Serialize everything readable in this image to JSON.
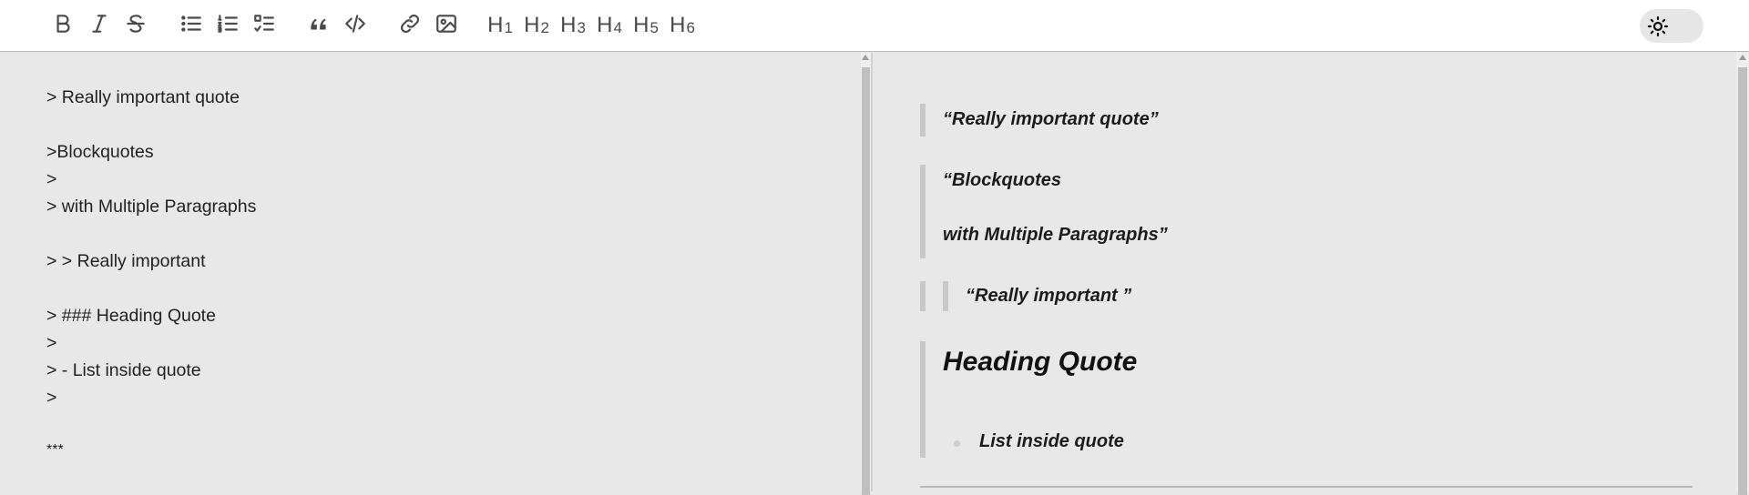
{
  "toolbar": {
    "headings": [
      {
        "letter": "H",
        "num": "1"
      },
      {
        "letter": "H",
        "num": "2"
      },
      {
        "letter": "H",
        "num": "3"
      },
      {
        "letter": "H",
        "num": "4"
      },
      {
        "letter": "H",
        "num": "5"
      },
      {
        "letter": "H",
        "num": "6"
      }
    ],
    "icons": [
      "bold-icon",
      "italic-icon",
      "strikethrough-icon",
      "bullet-list-icon",
      "numbered-list-icon",
      "task-list-icon",
      "quote-icon",
      "code-icon",
      "link-icon",
      "image-icon"
    ],
    "theme_icon": "sun-icon"
  },
  "editor": {
    "lines": [
      "> Really important quote",
      "",
      ">Blockquotes",
      ">",
      "> with Multiple Paragraphs",
      "",
      "> > Really important",
      "",
      "> ### Heading Quote",
      ">",
      "> - List inside quote",
      ">",
      "",
      "***"
    ]
  },
  "preview": {
    "quote1": "“Really important quote”",
    "quote2_line1": "“Blockquotes",
    "quote2_line2": "with Multiple Paragraphs”",
    "nested_quote": "“Really important ”",
    "heading_quote": "Heading Quote",
    "list_item": "List inside quote"
  },
  "colors": {
    "background": "#e8e8e8",
    "toolbar": "#ffffff",
    "blockquote_border": "#c8c8c8"
  }
}
